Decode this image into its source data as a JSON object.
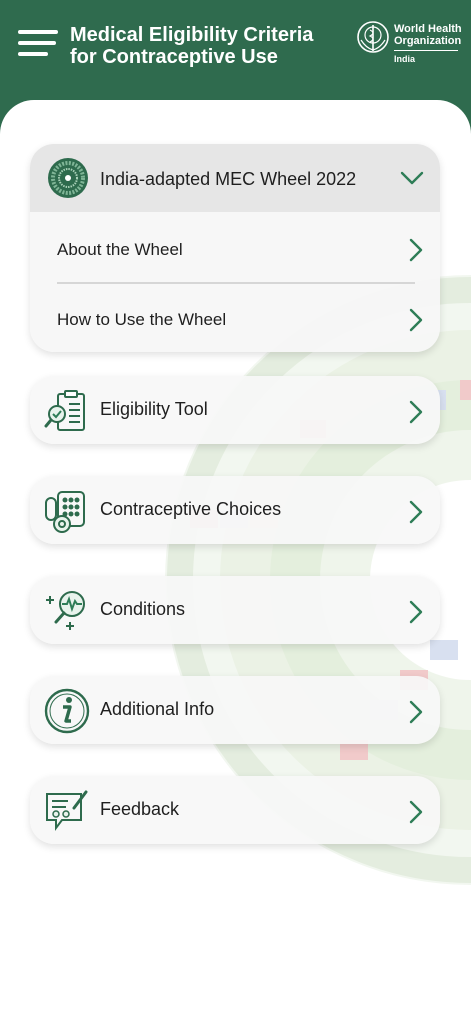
{
  "header": {
    "title_line1": "Medical Eligibility Criteria",
    "title_line2": "for Contraceptive Use",
    "who_line1": "World Health",
    "who_line2": "Organization",
    "who_country": "India"
  },
  "wheel_section": {
    "title": "India-adapted MEC Wheel 2022",
    "items": [
      {
        "label": "About the Wheel"
      },
      {
        "label": "How to Use the Wheel"
      }
    ]
  },
  "menu": [
    {
      "label": "Eligibility Tool",
      "icon": "clipboard-magnifier-icon"
    },
    {
      "label": "Contraceptive Choices",
      "icon": "contraceptives-icon"
    },
    {
      "label": "Conditions",
      "icon": "health-magnifier-icon"
    },
    {
      "label": "Additional Info",
      "icon": "info-icon"
    },
    {
      "label": "Feedback",
      "icon": "feedback-icon"
    }
  ],
  "colors": {
    "brand": "#2f6b4e",
    "card": "#f7f7f7",
    "accent": "#2e7d57"
  }
}
